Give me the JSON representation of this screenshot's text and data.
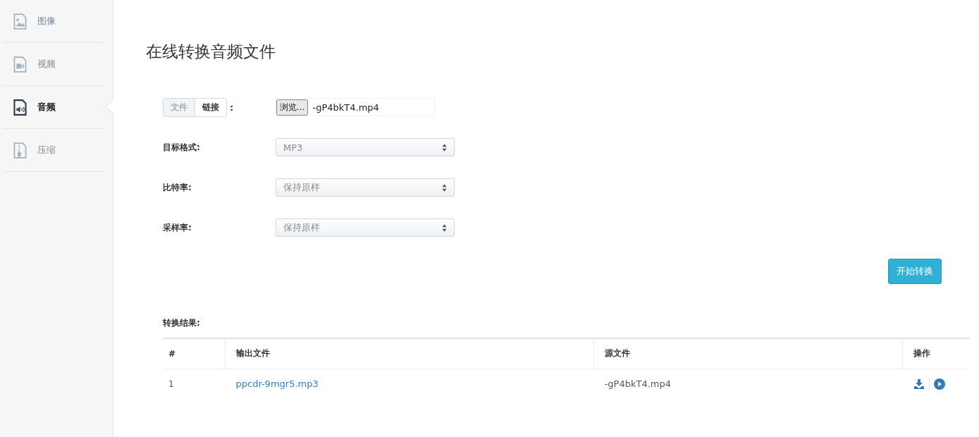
{
  "sidebar": {
    "items": [
      {
        "label": "图像",
        "kind": "image",
        "selected": false
      },
      {
        "label": "视频",
        "kind": "video",
        "selected": false
      },
      {
        "label": "音频",
        "kind": "audio",
        "selected": true
      },
      {
        "label": "压缩",
        "kind": "zip",
        "selected": false
      }
    ]
  },
  "title": "在线转换音频文件",
  "source": {
    "tabs": [
      {
        "label": "文件",
        "selected": true
      },
      {
        "label": "链接",
        "selected": false
      }
    ],
    "colon": ":",
    "browse_button": "浏览...",
    "file_name": "-gP4bkT4.mp4"
  },
  "fields": [
    {
      "label": "目标格式:",
      "value": "MP3"
    },
    {
      "label": "比特率:",
      "value": "保持原样"
    },
    {
      "label": "采样率:",
      "value": "保持原样"
    }
  ],
  "start_button": "开始转换",
  "results": {
    "label": "转换结果:",
    "columns": [
      "#",
      "输出文件",
      "源文件",
      "操作"
    ],
    "rows": [
      {
        "index": "1",
        "output": "ppcdr-9mgr5.mp3",
        "source": "-gP4bkT4.mp4"
      }
    ]
  }
}
